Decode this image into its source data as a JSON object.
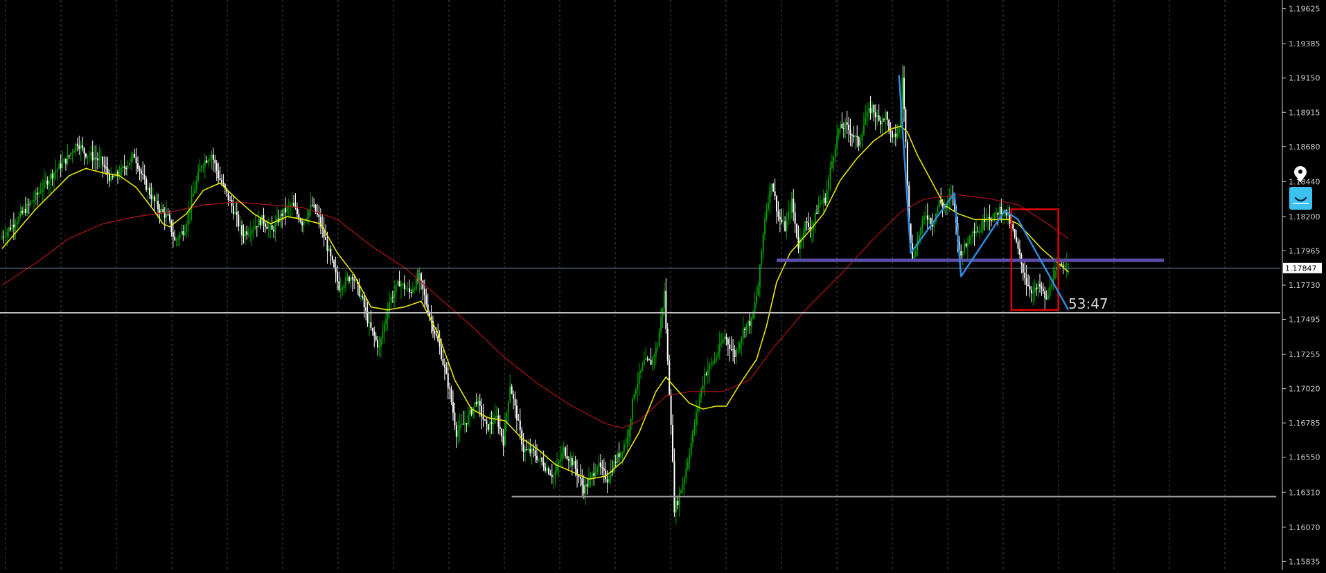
{
  "chart_data": {
    "type": "candlestick",
    "y_ticks": [
      "1.19625",
      "1.19385",
      "1.19150",
      "1.18915",
      "1.18680",
      "1.18440",
      "1.18200",
      "1.17965",
      "1.17730",
      "1.17495",
      "1.17255",
      "1.17020",
      "1.16785",
      "1.16550",
      "1.16310",
      "1.16070",
      "1.15835"
    ],
    "y_tick_values": [
      1.19625,
      1.19385,
      1.1915,
      1.18915,
      1.1868,
      1.1844,
      1.182,
      1.17965,
      1.1773,
      1.17495,
      1.17255,
      1.1702,
      1.16785,
      1.1655,
      1.1631,
      1.1607,
      1.15835
    ],
    "ylim": [
      1.15775,
      1.19685
    ],
    "grid": true,
    "current_price": "1.17847",
    "countdown": "53:47",
    "price_path": [
      [
        0,
        1.1805
      ],
      [
        10,
        1.1818
      ],
      [
        20,
        1.1832
      ],
      [
        30,
        1.1848
      ],
      [
        40,
        1.186
      ],
      [
        46,
        1.1871
      ],
      [
        50,
        1.1864
      ],
      [
        60,
        1.1858
      ],
      [
        66,
        1.1845
      ],
      [
        72,
        1.1851
      ],
      [
        80,
        1.1862
      ],
      [
        86,
        1.1843
      ],
      [
        90,
        1.1834
      ],
      [
        94,
        1.1826
      ],
      [
        100,
        1.1819
      ],
      [
        104,
        1.1803
      ],
      [
        110,
        1.1812
      ],
      [
        116,
        1.184
      ],
      [
        120,
        1.1856
      ],
      [
        126,
        1.1863
      ],
      [
        130,
        1.1848
      ],
      [
        134,
        1.1838
      ],
      [
        140,
        1.1822
      ],
      [
        144,
        1.1808
      ],
      [
        150,
        1.1812
      ],
      [
        156,
        1.1818
      ],
      [
        162,
        1.181
      ],
      [
        168,
        1.1822
      ],
      [
        174,
        1.1828
      ],
      [
        180,
        1.1816
      ],
      [
        186,
        1.1828
      ],
      [
        190,
        1.1818
      ],
      [
        196,
        1.1795
      ],
      [
        202,
        1.1772
      ],
      [
        210,
        1.178
      ],
      [
        216,
        1.1762
      ],
      [
        220,
        1.1745
      ],
      [
        226,
        1.173
      ],
      [
        232,
        1.1762
      ],
      [
        238,
        1.1775
      ],
      [
        244,
        1.1768
      ],
      [
        250,
        1.1778
      ],
      [
        256,
        1.1752
      ],
      [
        262,
        1.173
      ],
      [
        268,
        1.17
      ],
      [
        272,
        1.1672
      ],
      [
        278,
        1.168
      ],
      [
        284,
        1.1694
      ],
      [
        290,
        1.1675
      ],
      [
        296,
        1.1682
      ],
      [
        300,
        1.1666
      ],
      [
        304,
        1.1705
      ],
      [
        308,
        1.1683
      ],
      [
        312,
        1.166
      ],
      [
        318,
        1.1658
      ],
      [
        324,
        1.165
      ],
      [
        330,
        1.1642
      ],
      [
        336,
        1.166
      ],
      [
        342,
        1.165
      ],
      [
        348,
        1.1633
      ],
      [
        352,
        1.164
      ],
      [
        356,
        1.165
      ],
      [
        362,
        1.164
      ],
      [
        368,
        1.1655
      ],
      [
        374,
        1.1668
      ],
      [
        378,
        1.17
      ],
      [
        384,
        1.172
      ],
      [
        388,
        1.172
      ],
      [
        392,
        1.1732
      ],
      [
        396,
        1.1768
      ],
      [
        398,
        1.172
      ],
      [
        400,
        1.168
      ],
      [
        402,
        1.162
      ],
      [
        404,
        1.1625
      ],
      [
        408,
        1.1642
      ],
      [
        412,
        1.1665
      ],
      [
        416,
        1.169
      ],
      [
        420,
        1.1712
      ],
      [
        426,
        1.1722
      ],
      [
        432,
        1.1738
      ],
      [
        438,
        1.1725
      ],
      [
        444,
        1.1745
      ],
      [
        448,
        1.1748
      ],
      [
        452,
        1.1772
      ],
      [
        456,
        1.182
      ],
      [
        460,
        1.1845
      ],
      [
        464,
        1.182
      ],
      [
        468,
        1.1812
      ],
      [
        472,
        1.183
      ],
      [
        476,
        1.18
      ],
      [
        480,
        1.1815
      ],
      [
        484,
        1.1812
      ],
      [
        488,
        1.1828
      ],
      [
        492,
        1.1832
      ],
      [
        496,
        1.1858
      ],
      [
        500,
        1.188
      ],
      [
        504,
        1.1882
      ],
      [
        508,
        1.1877
      ],
      [
        512,
        1.187
      ],
      [
        516,
        1.1888
      ],
      [
        520,
        1.1895
      ],
      [
        524,
        1.1885
      ],
      [
        528,
        1.189
      ],
      [
        532,
        1.1872
      ],
      [
        536,
        1.188
      ],
      [
        538,
        1.1916
      ],
      [
        540,
        1.187
      ],
      [
        542,
        1.1818
      ],
      [
        544,
        1.179
      ],
      [
        548,
        1.1808
      ],
      [
        552,
        1.1822
      ],
      [
        556,
        1.1815
      ],
      [
        560,
        1.183
      ],
      [
        564,
        1.1826
      ],
      [
        568,
        1.1836
      ],
      [
        572,
        1.1795
      ],
      [
        576,
        1.18
      ],
      [
        580,
        1.1812
      ],
      [
        584,
        1.181
      ],
      [
        588,
        1.1822
      ],
      [
        592,
        1.1818
      ],
      [
        596,
        1.1825
      ],
      [
        600,
        1.1822
      ],
      [
        604,
        1.181
      ],
      [
        608,
        1.1792
      ],
      [
        612,
        1.1775
      ],
      [
        616,
        1.1768
      ],
      [
        620,
        1.1772
      ],
      [
        624,
        1.1762
      ],
      [
        628,
        1.178
      ],
      [
        632,
        1.1785
      ],
      [
        636,
        1.179
      ]
    ],
    "ma_fast": [
      [
        0,
        1.1798
      ],
      [
        20,
        1.1825
      ],
      [
        40,
        1.1848
      ],
      [
        50,
        1.1853
      ],
      [
        60,
        1.185
      ],
      [
        70,
        1.1848
      ],
      [
        80,
        1.184
      ],
      [
        90,
        1.1825
      ],
      [
        96,
        1.1815
      ],
      [
        100,
        1.1813
      ],
      [
        110,
        1.1822
      ],
      [
        120,
        1.1838
      ],
      [
        130,
        1.1843
      ],
      [
        140,
        1.1832
      ],
      [
        150,
        1.1822
      ],
      [
        160,
        1.1815
      ],
      [
        170,
        1.182
      ],
      [
        180,
        1.1818
      ],
      [
        190,
        1.1815
      ],
      [
        200,
        1.1795
      ],
      [
        210,
        1.178
      ],
      [
        220,
        1.1758
      ],
      [
        230,
        1.1756
      ],
      [
        240,
        1.1758
      ],
      [
        250,
        1.1762
      ],
      [
        260,
        1.174
      ],
      [
        270,
        1.1708
      ],
      [
        280,
        1.1688
      ],
      [
        290,
        1.1682
      ],
      [
        300,
        1.168
      ],
      [
        310,
        1.1668
      ],
      [
        320,
        1.166
      ],
      [
        330,
        1.165
      ],
      [
        340,
        1.1645
      ],
      [
        350,
        1.164
      ],
      [
        360,
        1.1642
      ],
      [
        370,
        1.1652
      ],
      [
        380,
        1.1672
      ],
      [
        390,
        1.17
      ],
      [
        396,
        1.171
      ],
      [
        402,
        1.1702
      ],
      [
        410,
        1.1692
      ],
      [
        418,
        1.1688
      ],
      [
        426,
        1.169
      ],
      [
        432,
        1.169
      ],
      [
        440,
        1.1705
      ],
      [
        450,
        1.1722
      ],
      [
        456,
        1.1745
      ],
      [
        462,
        1.1775
      ],
      [
        470,
        1.1795
      ],
      [
        480,
        1.1808
      ],
      [
        490,
        1.1822
      ],
      [
        500,
        1.1845
      ],
      [
        510,
        1.186
      ],
      [
        520,
        1.1872
      ],
      [
        530,
        1.188
      ],
      [
        536,
        1.1882
      ],
      [
        540,
        1.1878
      ],
      [
        546,
        1.1862
      ],
      [
        554,
        1.1845
      ],
      [
        562,
        1.1828
      ],
      [
        570,
        1.1822
      ],
      [
        580,
        1.1818
      ],
      [
        590,
        1.1818
      ],
      [
        600,
        1.1818
      ],
      [
        606,
        1.1815
      ],
      [
        612,
        1.1808
      ],
      [
        620,
        1.1798
      ],
      [
        628,
        1.179
      ],
      [
        636,
        1.1782
      ]
    ],
    "ma_slow": [
      [
        0,
        1.1773
      ],
      [
        20,
        1.1788
      ],
      [
        40,
        1.1805
      ],
      [
        60,
        1.1815
      ],
      [
        80,
        1.182
      ],
      [
        100,
        1.1823
      ],
      [
        120,
        1.1828
      ],
      [
        140,
        1.183
      ],
      [
        160,
        1.1828
      ],
      [
        180,
        1.1826
      ],
      [
        200,
        1.1818
      ],
      [
        220,
        1.18
      ],
      [
        240,
        1.1785
      ],
      [
        260,
        1.1765
      ],
      [
        280,
        1.1745
      ],
      [
        300,
        1.1723
      ],
      [
        320,
        1.1705
      ],
      [
        340,
        1.169
      ],
      [
        360,
        1.1678
      ],
      [
        370,
        1.1675
      ],
      [
        380,
        1.168
      ],
      [
        396,
        1.1697
      ],
      [
        410,
        1.17
      ],
      [
        430,
        1.17
      ],
      [
        446,
        1.1708
      ],
      [
        460,
        1.173
      ],
      [
        480,
        1.1757
      ],
      [
        500,
        1.178
      ],
      [
        520,
        1.1805
      ],
      [
        536,
        1.1823
      ],
      [
        550,
        1.1832
      ],
      [
        570,
        1.1835
      ],
      [
        590,
        1.1832
      ],
      [
        606,
        1.1828
      ],
      [
        620,
        1.1818
      ],
      [
        636,
        1.1805
      ]
    ],
    "drawn_objects": {
      "support_line": {
        "price": 1.1754,
        "color": "#bfbfbf"
      },
      "low_line": {
        "price": 1.1628,
        "x_from": 304,
        "x_to": 760,
        "color": "#9a9a9a"
      },
      "zone_line": {
        "price": 1.179,
        "x_from": 462,
        "x_to": 693,
        "color": "#5b4ea8"
      },
      "current_price_line": {
        "price": 1.17847,
        "color": "#7f8ea6"
      },
      "box": {
        "x_from": 602,
        "x_to": 630,
        "price_top": 1.1825,
        "price_bottom": 1.1756,
        "color": "#e00000"
      },
      "zigzag": {
        "color": "#2e8de0",
        "points": [
          [
            535,
            1.1917
          ],
          [
            542,
            1.1795
          ],
          [
            568,
            1.1836
          ],
          [
            572,
            1.1779
          ],
          [
            598,
            1.1824
          ],
          [
            606,
            1.1818
          ],
          [
            636,
            1.1756
          ]
        ]
      }
    },
    "title": "",
    "xlabel": "",
    "ylabel": ""
  },
  "colors": {
    "background": "#000000",
    "grid": "#4a4a4a",
    "axis_text": "#d0d0d0",
    "candle_up": "#00a000",
    "candle_down": "#ffffff",
    "ma_fast": "#e8e800",
    "ma_slow": "#b31414",
    "price_tag_bg": "#ffffff",
    "price_tag_text": "#000000",
    "app_icon": "#3cc2f2"
  },
  "icons": [
    "indicator-pin-icon",
    "app-chat-icon"
  ]
}
